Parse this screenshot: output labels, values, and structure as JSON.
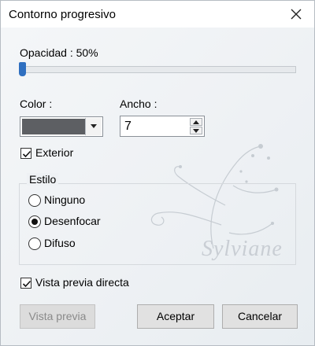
{
  "window": {
    "title": "Contorno progresivo"
  },
  "opacity": {
    "label": "Opacidad : 50%",
    "value_percent": 50
  },
  "color": {
    "label": "Color :",
    "swatch_hex": "#5d5f63"
  },
  "width": {
    "label": "Ancho :",
    "value": "7"
  },
  "exterior": {
    "label": "Exterior",
    "checked": true
  },
  "style_group": {
    "title": "Estilo",
    "options": [
      {
        "label": "Ninguno",
        "selected": false
      },
      {
        "label": "Desenfocar",
        "selected": true
      },
      {
        "label": "Difuso",
        "selected": false
      }
    ]
  },
  "preview_direct": {
    "label": "Vista previa directa",
    "checked": true
  },
  "buttons": {
    "preview": "Vista previa",
    "accept": "Aceptar",
    "cancel": "Cancelar"
  },
  "watermark": {
    "text": "Sylviane"
  }
}
